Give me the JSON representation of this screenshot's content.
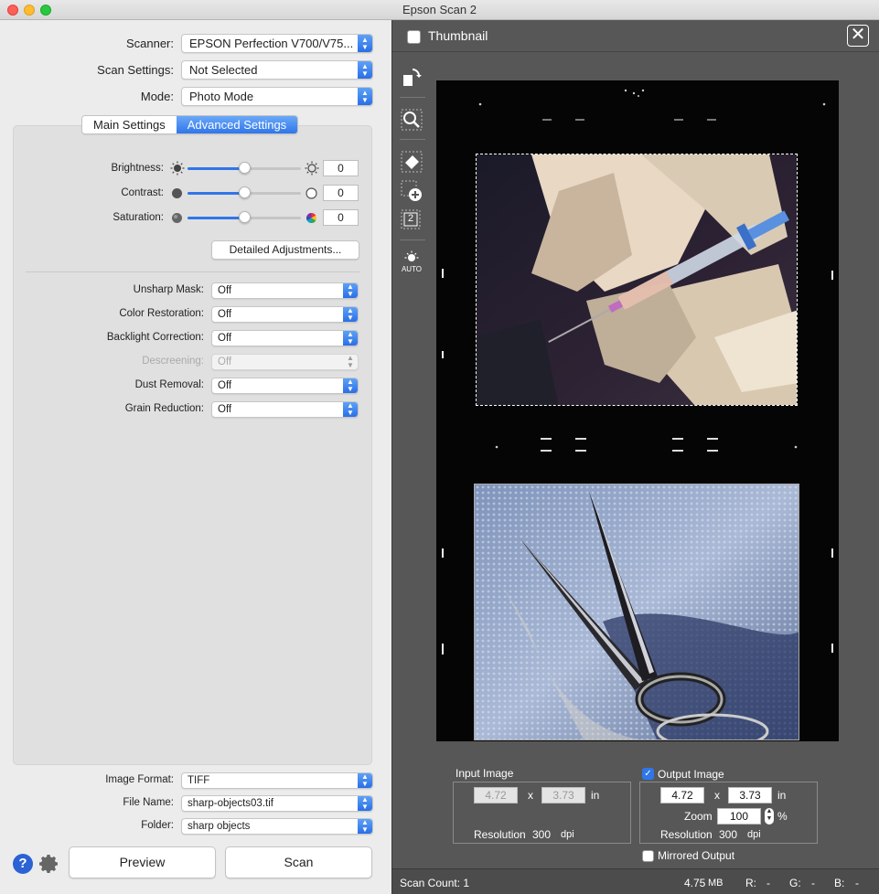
{
  "window": {
    "title": "Epson Scan 2"
  },
  "scanner": {
    "label": "Scanner:",
    "value": "EPSON Perfection V700/V75..."
  },
  "scan_settings": {
    "label": "Scan Settings:",
    "value": "Not Selected"
  },
  "mode": {
    "label": "Mode:",
    "value": "Photo Mode"
  },
  "tabs": [
    {
      "label": "Main Settings",
      "active": false
    },
    {
      "label": "Advanced Settings",
      "active": true
    }
  ],
  "adjustments": {
    "brightness": {
      "label": "Brightness:",
      "value": "0",
      "level": 0.5
    },
    "contrast": {
      "label": "Contrast:",
      "value": "0",
      "level": 0.5
    },
    "saturation": {
      "label": "Saturation:",
      "value": "0",
      "level": 0.5
    },
    "detailed_button": "Detailed Adjustments..."
  },
  "options": [
    {
      "label": "Unsharp Mask:",
      "value": "Off",
      "disabled": false
    },
    {
      "label": "Color Restoration:",
      "value": "Off",
      "disabled": false
    },
    {
      "label": "Backlight Correction:",
      "value": "Off",
      "disabled": false
    },
    {
      "label": "Descreening:",
      "value": "Off",
      "disabled": true
    },
    {
      "label": "Dust Removal:",
      "value": "Off",
      "disabled": false
    },
    {
      "label": "Grain Reduction:",
      "value": "Off",
      "disabled": false
    }
  ],
  "output": {
    "image_format": {
      "label": "Image Format:",
      "value": "TIFF"
    },
    "file_name": {
      "label": "File Name:",
      "value": "sharp-objects03.tif"
    },
    "folder": {
      "label": "Folder:",
      "value": "sharp objects"
    }
  },
  "buttons": {
    "preview": "Preview",
    "scan": "Scan",
    "help": "?"
  },
  "thumbnail": {
    "label": "Thumbnail",
    "checked": false
  },
  "toolbar": {
    "auto_label": "AUTO",
    "multi_label": "2"
  },
  "input_image": {
    "title": "Input Image",
    "width": "4.72",
    "x": "x",
    "height": "3.73",
    "unit": "in",
    "resolution_label": "Resolution",
    "resolution": "300",
    "resolution_unit": "dpi"
  },
  "output_image": {
    "title": "Output Image",
    "checked": true,
    "width": "4.72",
    "x": "x",
    "height": "3.73",
    "unit": "in",
    "zoom_label": "Zoom",
    "zoom": "100",
    "zoom_unit": "%",
    "resolution_label": "Resolution",
    "resolution": "300",
    "resolution_unit": "dpi"
  },
  "mirrored_output": {
    "label": "Mirrored Output",
    "checked": false
  },
  "status": {
    "scan_count": "Scan Count: 1",
    "size": "4.75",
    "size_unit": "MB",
    "r_label": "R:",
    "r_value": "-",
    "g_label": "G:",
    "g_value": "-",
    "b_label": "B:",
    "b_value": "-"
  },
  "colors": {
    "accent": "#2f76e9",
    "panel_dark": "#575757",
    "panel_light": "#ececec"
  }
}
